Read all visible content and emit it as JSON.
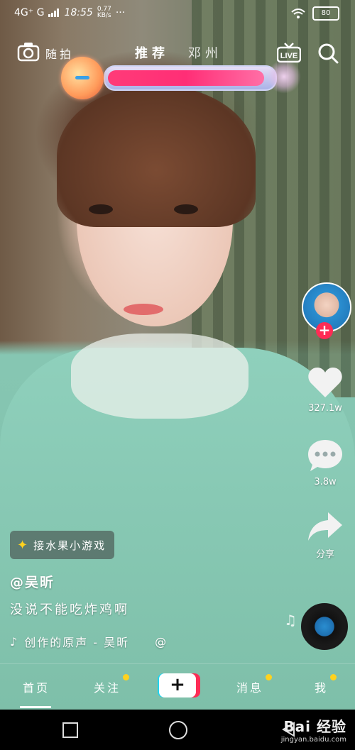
{
  "status_bar": {
    "network": "4G⁺ G",
    "time": "18:55",
    "speed_top": "0.77",
    "speed_unit": "KB/s",
    "more": "···",
    "battery": "80"
  },
  "top_nav": {
    "snapshot_label": "随拍",
    "tabs": [
      {
        "label": "推荐",
        "active": true
      },
      {
        "label": "邓州",
        "active": false
      }
    ],
    "live_label": "LIVE"
  },
  "game_bar": {
    "progress": 0.95,
    "colors": {
      "fill": "#ff2e76",
      "orb": "#ff9a5a"
    }
  },
  "rail": {
    "likes": "327.1w",
    "comments": "3.8w",
    "share_label": "分享"
  },
  "post": {
    "game_chip": "接水果小游戏",
    "author": "@吴昕",
    "caption": "没说不能吃炸鸡啊",
    "sound": "创作的原声 - 吴昕",
    "sound_suffix": "@"
  },
  "tab_bar": {
    "items": [
      {
        "label": "首页",
        "dot": false,
        "active": true
      },
      {
        "label": "关注",
        "dot": true,
        "active": false
      },
      {
        "label": "消息",
        "dot": true,
        "active": false
      },
      {
        "label": "我",
        "dot": true,
        "active": false
      }
    ],
    "create_label": "+"
  },
  "watermark": {
    "brand": "Bai 经验",
    "url": "jingyan.baidu.com"
  },
  "colors": {
    "accent_red": "#fe2c55",
    "accent_cyan": "#22d3ee",
    "notify_dot": "#ffd21e"
  }
}
